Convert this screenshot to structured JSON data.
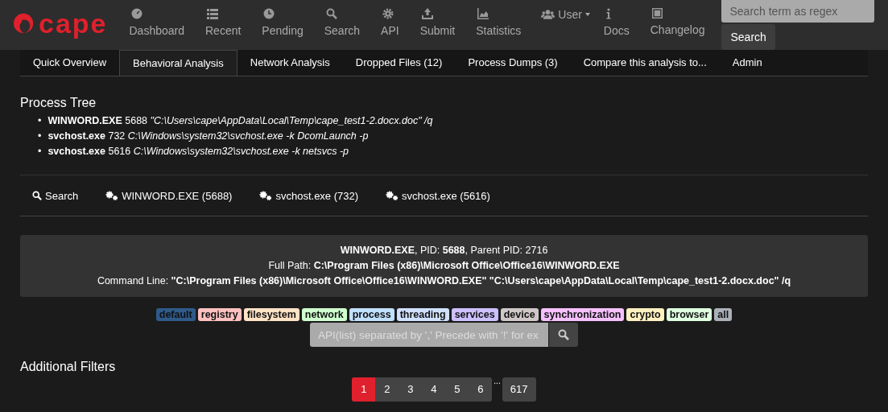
{
  "brand": "cape",
  "nav": [
    {
      "label": "Dashboard"
    },
    {
      "label": "Recent"
    },
    {
      "label": "Pending"
    },
    {
      "label": "Search"
    },
    {
      "label": "API"
    },
    {
      "label": "Submit"
    },
    {
      "label": "Statistics"
    }
  ],
  "user_menu": {
    "label": "User"
  },
  "nav2": [
    {
      "label": "Docs"
    },
    {
      "label": "Changelog"
    }
  ],
  "search": {
    "placeholder": "Search term as regex",
    "button": "Search"
  },
  "tabs": [
    {
      "label": "Quick Overview",
      "selected": false
    },
    {
      "label": "Behavioral Analysis",
      "selected": true
    },
    {
      "label": "Network Analysis",
      "selected": false
    },
    {
      "label": "Dropped Files (12)",
      "selected": false
    },
    {
      "label": "Process Dumps (3)",
      "selected": false
    },
    {
      "label": "Compare this analysis to...",
      "selected": false
    },
    {
      "label": "Admin",
      "selected": false
    }
  ],
  "process_tree": {
    "title": "Process Tree",
    "items": [
      {
        "bullet": "•",
        "name": "WINWORD.EXE",
        "pid": "5688",
        "command": "\"C:\\Users\\cape\\AppData\\Local\\Temp\\cape_test1-2.docx.doc\" /q"
      },
      {
        "bullet": "•",
        "name": "svchost.exe",
        "pid": "732",
        "command": "C:\\Windows\\system32\\svchost.exe -k DcomLaunch -p"
      },
      {
        "bullet": "•",
        "name": "svchost.exe",
        "pid": "5616",
        "command": "C:\\Windows\\system32\\svchost.exe -k netsvcs -p"
      }
    ]
  },
  "process_tabs": [
    {
      "kind": "search",
      "label": "Search",
      "selected": false
    },
    {
      "kind": "process",
      "label": "WINWORD.EXE (5688)",
      "selected": false
    },
    {
      "kind": "process",
      "label": "svchost.exe (732)",
      "selected": false
    },
    {
      "kind": "process",
      "label": "svchost.exe (5616)",
      "selected": false
    }
  ],
  "process_info": {
    "line_1": "**WINWORD.EXE**, PID: **5688**, Parent PID: 2716",
    "line_2": "Full Path: **C:\\Program Files (x86)\\Microsoft Office\\Office16\\WINWORD.EXE**",
    "line_3": "Command Line: **\"C:\\Program Files (x86)\\Microsoft Office\\Office16\\WINWORD.EXE\" \"C:\\Users\\cape\\AppData\\Local\\Temp\\cape_test1-2.docx.doc\" /q**"
  },
  "categories": [
    {
      "label": "default",
      "color": "#2f5a8a"
    },
    {
      "label": "registry",
      "color": "#ffc0c0"
    },
    {
      "label": "filesystem",
      "color": "#ffe3c5"
    },
    {
      "label": "network",
      "color": "#d0ffd0"
    },
    {
      "label": "process",
      "color": "#c0e0ff"
    },
    {
      "label": "threading",
      "color": "#d0e0ff"
    },
    {
      "label": "services",
      "color": "#ccc0ff"
    },
    {
      "label": "device",
      "color": "#d0c8c8"
    },
    {
      "label": "synchronization",
      "color": "#f6c0ff"
    },
    {
      "label": "crypto",
      "color": "#fff0c0"
    },
    {
      "label": "browser",
      "color": "#dfffdf"
    },
    {
      "label": "all",
      "color": "#aab0b8"
    }
  ],
  "api_filter": {
    "placeholder": "API(list) separated by ',' Precede with '!' for ex"
  },
  "additional_filters": "Additional Filters",
  "pagination": {
    "pages": [
      {
        "label": "1",
        "selected": true
      },
      {
        "label": "2",
        "selected": false
      },
      {
        "label": "3",
        "selected": false
      },
      {
        "label": "4",
        "selected": false
      },
      {
        "label": "5",
        "selected": false
      },
      {
        "label": "6",
        "selected": false
      }
    ],
    "ellipsis": "...",
    "last": "617"
  }
}
